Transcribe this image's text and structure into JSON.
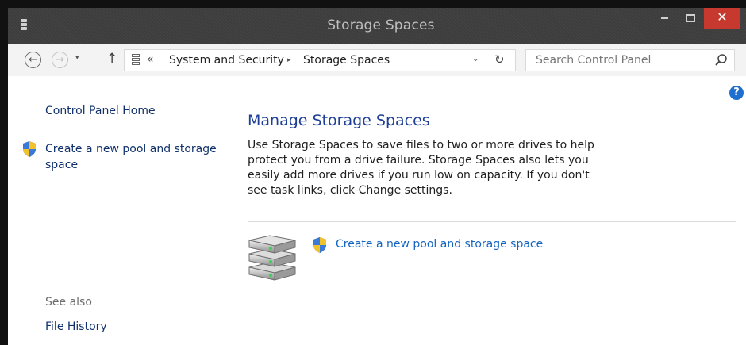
{
  "window": {
    "title": "Storage Spaces",
    "minimize_label": "minimize",
    "maximize_label": "maximize",
    "close_label": "✕"
  },
  "nav": {
    "back": "←",
    "forward": "→",
    "recent": "▾",
    "up": "↑",
    "overflow": "«",
    "breadcrumb": [
      "System and Security",
      "Storage Spaces"
    ],
    "separator": "▸",
    "dropdown": "⌄",
    "refresh": "↻",
    "search_placeholder": "Search Control Panel"
  },
  "help": "?",
  "left_pane": {
    "home_link": "Control Panel Home",
    "create_link": "Create a new pool and storage space",
    "see_also_label": "See also",
    "see_also_links": [
      "File History"
    ]
  },
  "main": {
    "heading": "Manage Storage Spaces",
    "description": "Use Storage Spaces to save files to two or more drives to help protect you from a drive failure. Storage Spaces also lets you easily add more drives if you run low on capacity. If you don't see task links, click Change settings.",
    "task_link": "Create a new pool and storage space"
  },
  "colors": {
    "link": "#1565c0",
    "heading": "#1e3f96",
    "close_button": "#c7392f"
  },
  "icons": {
    "app": "storage-spaces-icon",
    "shield": "uac-shield-icon",
    "drives": "stacked-drives-icon"
  }
}
